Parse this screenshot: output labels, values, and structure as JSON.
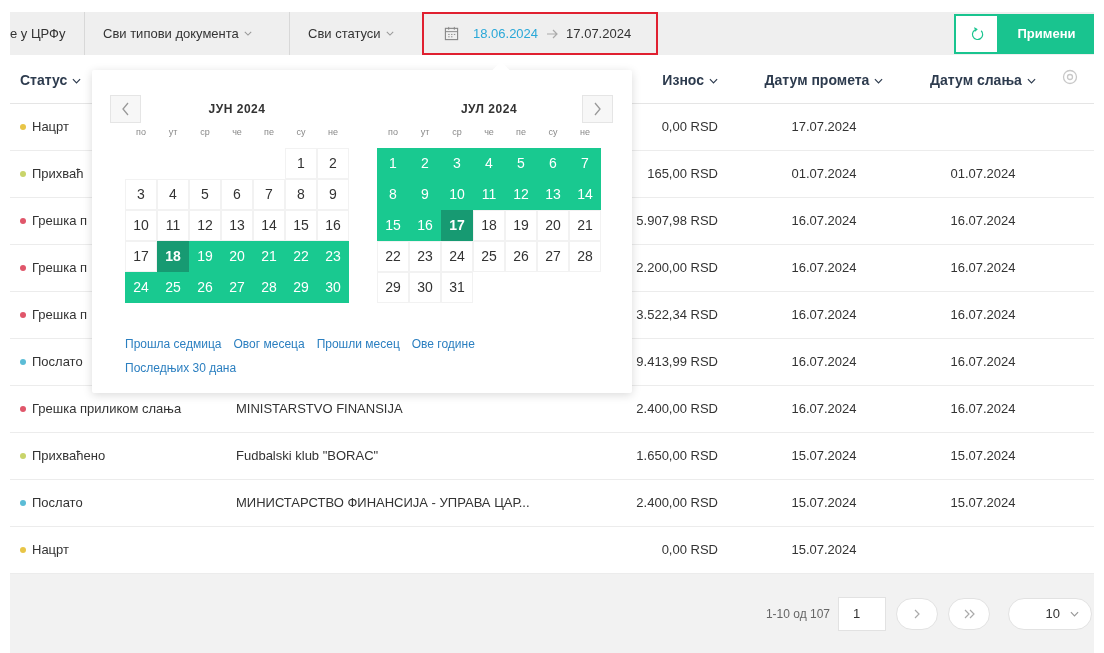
{
  "filter_bar": {
    "items": [
      {
        "kind": "text",
        "label": "е у ЦРФу"
      },
      {
        "kind": "dropdown",
        "label": "Сви типови документа"
      },
      {
        "kind": "dropdown",
        "label": "Сви статуси"
      }
    ],
    "date_range": {
      "start": {
        "value": "18.06.2024",
        "active": true
      },
      "end": {
        "value": "17.07.2024",
        "active": false
      },
      "highlighted": true
    },
    "apply_button": {
      "label": "Примени"
    }
  },
  "table": {
    "columns": [
      {
        "label": "Статус"
      },
      {
        "label": "Износ"
      },
      {
        "label": "Датум промета"
      },
      {
        "label": "Датум слања"
      }
    ],
    "rows": [
      {
        "status": "Нацрт",
        "color": "#e8c547",
        "amount": "0,00 RSD",
        "turnover_date": "17.07.2024"
      },
      {
        "status": "Прихваћ",
        "color": "#c9d46a",
        "amount": "165,00 RSD",
        "turnover_date": "01.07.2024",
        "sent_date": "01.07.2024"
      },
      {
        "status": "Грешка п",
        "color": "#e0566a",
        "amount": "5.907,98 RSD",
        "turnover_date": "16.07.2024",
        "sent_date": "16.07.2024"
      },
      {
        "status": "Грешка п",
        "color": "#e0566a",
        "amount": "2.200,00 RSD",
        "turnover_date": "16.07.2024",
        "sent_date": "16.07.2024"
      },
      {
        "status": "Грешка п",
        "color": "#e0566a",
        "amount": "3.522,34 RSD",
        "turnover_date": "16.07.2024",
        "sent_date": "16.07.2024"
      },
      {
        "status": "Послато",
        "color": "#5bbcd6",
        "amount": "9.413,99 RSD",
        "turnover_date": "16.07.2024",
        "sent_date": "16.07.2024"
      },
      {
        "status": "Грешка приликом слања",
        "color": "#e0566a",
        "name": "MINISTARSTVO FINANSIJA",
        "amount": "2.400,00 RSD",
        "turnover_date": "16.07.2024",
        "sent_date": "16.07.2024"
      },
      {
        "status": "Прихваћено",
        "color": "#c9d46a",
        "name": "Fudbalski klub \"BORAC\"",
        "amount": "1.650,00 RSD",
        "turnover_date": "15.07.2024",
        "sent_date": "15.07.2024"
      },
      {
        "status": "Послато",
        "color": "#5bbcd6",
        "name": "МИНИСТАРСТВО ФИНАНСИЈА - УПРАВА ЦАР...",
        "amount": "2.400,00 RSD",
        "turnover_date": "15.07.2024",
        "sent_date": "15.07.2024"
      },
      {
        "status": "Нацрт",
        "color": "#e8c547",
        "amount": "0,00 RSD",
        "turnover_date": "15.07.2024"
      }
    ]
  },
  "calendar": {
    "months": [
      {
        "title": "ЈУН 2024",
        "weekdays": [
          "по",
          "ут",
          "ср",
          "че",
          "пе",
          "су",
          "не"
        ],
        "weeks": [
          [
            {
              "day": "1",
              "in_range": false,
              "selected": false
            },
            {
              "day": "2",
              "in_range": false,
              "selected": false
            }
          ],
          [
            {
              "day": "3",
              "in_range": false,
              "selected": false
            },
            {
              "day": "4",
              "in_range": false,
              "selected": false
            },
            {
              "day": "5",
              "in_range": false,
              "selected": false
            },
            {
              "day": "6",
              "in_range": false,
              "selected": false
            },
            {
              "day": "7",
              "in_range": false,
              "selected": false
            },
            {
              "day": "8",
              "in_range": false,
              "selected": false
            },
            {
              "day": "9",
              "in_range": false,
              "selected": false
            }
          ],
          [
            {
              "day": "10",
              "in_range": false,
              "selected": false
            },
            {
              "day": "11",
              "in_range": false,
              "selected": false
            },
            {
              "day": "12",
              "in_range": false,
              "selected": false
            },
            {
              "day": "13",
              "in_range": false,
              "selected": false
            },
            {
              "day": "14",
              "in_range": false,
              "selected": false
            },
            {
              "day": "15",
              "in_range": false,
              "selected": false
            },
            {
              "day": "16",
              "in_range": false,
              "selected": false
            }
          ],
          [
            {
              "day": "17",
              "in_range": false,
              "selected": false
            },
            {
              "day": "18",
              "in_range": true,
              "selected": true
            },
            {
              "day": "19",
              "in_range": true,
              "selected": false
            },
            {
              "day": "20",
              "in_range": true,
              "selected": false
            },
            {
              "day": "21",
              "in_range": true,
              "selected": false
            },
            {
              "day": "22",
              "in_range": true,
              "selected": false
            },
            {
              "day": "23",
              "in_range": true,
              "selected": false
            }
          ],
          [
            {
              "day": "24",
              "in_range": true,
              "selected": false
            },
            {
              "day": "25",
              "in_range": true,
              "selected": false
            },
            {
              "day": "26",
              "in_range": true,
              "selected": false
            },
            {
              "day": "27",
              "in_range": true,
              "selected": false
            },
            {
              "day": "28",
              "in_range": true,
              "selected": false
            },
            {
              "day": "29",
              "in_range": true,
              "selected": false
            },
            {
              "day": "30",
              "in_range": true,
              "selected": false
            }
          ]
        ]
      },
      {
        "title": "ЈУЛ 2024",
        "weekdays": [
          "по",
          "ут",
          "ср",
          "че",
          "пе",
          "су",
          "не"
        ],
        "weeks": [
          [
            {
              "day": "1",
              "in_range": true,
              "selected": false
            },
            {
              "day": "2",
              "in_range": true,
              "selected": false
            },
            {
              "day": "3",
              "in_range": true,
              "selected": false
            },
            {
              "day": "4",
              "in_range": true,
              "selected": false
            },
            {
              "day": "5",
              "in_range": true,
              "selected": false
            },
            {
              "day": "6",
              "in_range": true,
              "selected": false
            },
            {
              "day": "7",
              "in_range": true,
              "selected": false
            }
          ],
          [
            {
              "day": "8",
              "in_range": true,
              "selected": false
            },
            {
              "day": "9",
              "in_range": true,
              "selected": false
            },
            {
              "day": "10",
              "in_range": true,
              "selected": false
            },
            {
              "day": "11",
              "in_range": true,
              "selected": false
            },
            {
              "day": "12",
              "in_range": true,
              "selected": false
            },
            {
              "day": "13",
              "in_range": true,
              "selected": false
            },
            {
              "day": "14",
              "in_range": true,
              "selected": false
            }
          ],
          [
            {
              "day": "15",
              "in_range": true,
              "selected": false
            },
            {
              "day": "16",
              "in_range": true,
              "selected": false
            },
            {
              "day": "17",
              "in_range": true,
              "selected": true
            },
            {
              "day": "18",
              "in_range": false,
              "selected": false
            },
            {
              "day": "19",
              "in_range": false,
              "selected": false
            },
            {
              "day": "20",
              "in_range": false,
              "selected": false
            },
            {
              "day": "21",
              "in_range": false,
              "selected": false
            }
          ],
          [
            {
              "day": "22",
              "in_range": false,
              "selected": false
            },
            {
              "day": "23",
              "in_range": false,
              "selected": false
            },
            {
              "day": "24",
              "in_range": false,
              "selected": false
            },
            {
              "day": "25",
              "in_range": false,
              "selected": false
            },
            {
              "day": "26",
              "in_range": false,
              "selected": false
            },
            {
              "day": "27",
              "in_range": false,
              "selected": false
            },
            {
              "day": "28",
              "in_range": false,
              "selected": false
            }
          ],
          [
            {
              "day": "29",
              "in_range": false,
              "selected": false
            },
            {
              "day": "30",
              "in_range": false,
              "selected": false
            },
            {
              "day": "31",
              "in_range": false,
              "selected": false
            }
          ]
        ]
      }
    ],
    "shortcuts": [
      "Прошла седмица",
      "Овог месеца",
      "Прошли месец",
      "Ове године",
      "Последњих 30 дана"
    ]
  },
  "pagination": {
    "range": "1-10 од 107",
    "page": "1",
    "per_page": "10"
  }
}
